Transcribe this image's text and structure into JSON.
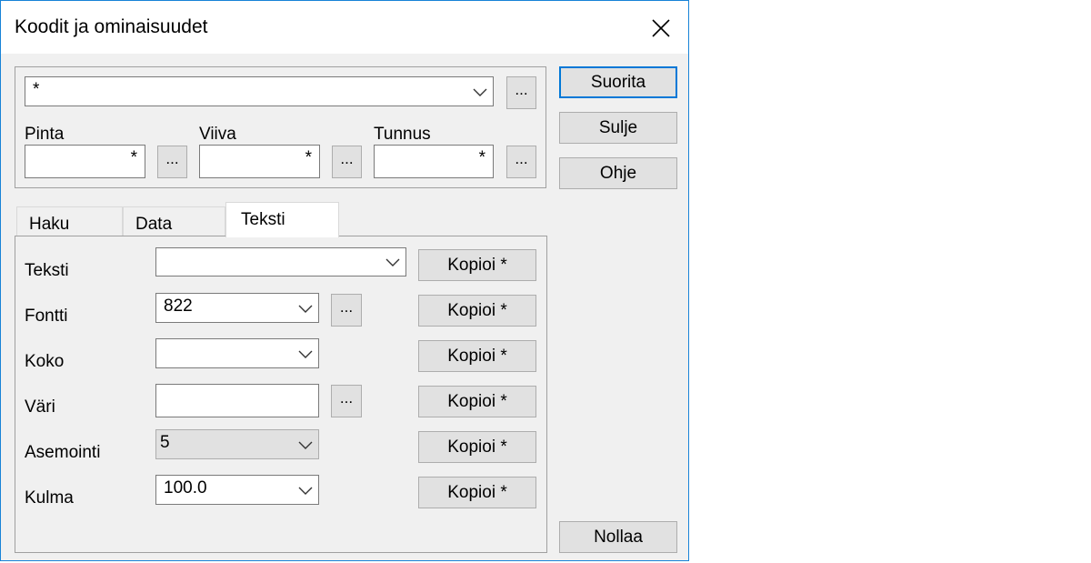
{
  "window": {
    "title": "Koodit ja ominaisuudet",
    "close_icon": "close-icon"
  },
  "filter": {
    "code_value": "*",
    "more_label": "...",
    "pinta": {
      "label": "Pinta",
      "value": "*"
    },
    "viiva": {
      "label": "Viiva",
      "value": "*"
    },
    "tunnus": {
      "label": "Tunnus",
      "value": "*"
    }
  },
  "buttons": {
    "run": "Suorita",
    "close": "Sulje",
    "help": "Ohje",
    "reset": "Nollaa"
  },
  "tabs": [
    {
      "label": "Haku",
      "active": false
    },
    {
      "label": "Data",
      "active": false
    },
    {
      "label": "Teksti",
      "active": true
    }
  ],
  "teksti_tab": {
    "copy_label": "Kopioi *",
    "rows": [
      {
        "label": "Teksti",
        "value": ""
      },
      {
        "label": "Fontti",
        "value": "822"
      },
      {
        "label": "Koko",
        "value": ""
      },
      {
        "label": "Väri",
        "value": ""
      },
      {
        "label": "Asemointi",
        "value": "5"
      },
      {
        "label": "Kulma",
        "value": "100.0"
      }
    ]
  },
  "colors": {
    "accent": "#0078d7",
    "window_border": "#1883d7",
    "background": "#f0f0f0"
  }
}
